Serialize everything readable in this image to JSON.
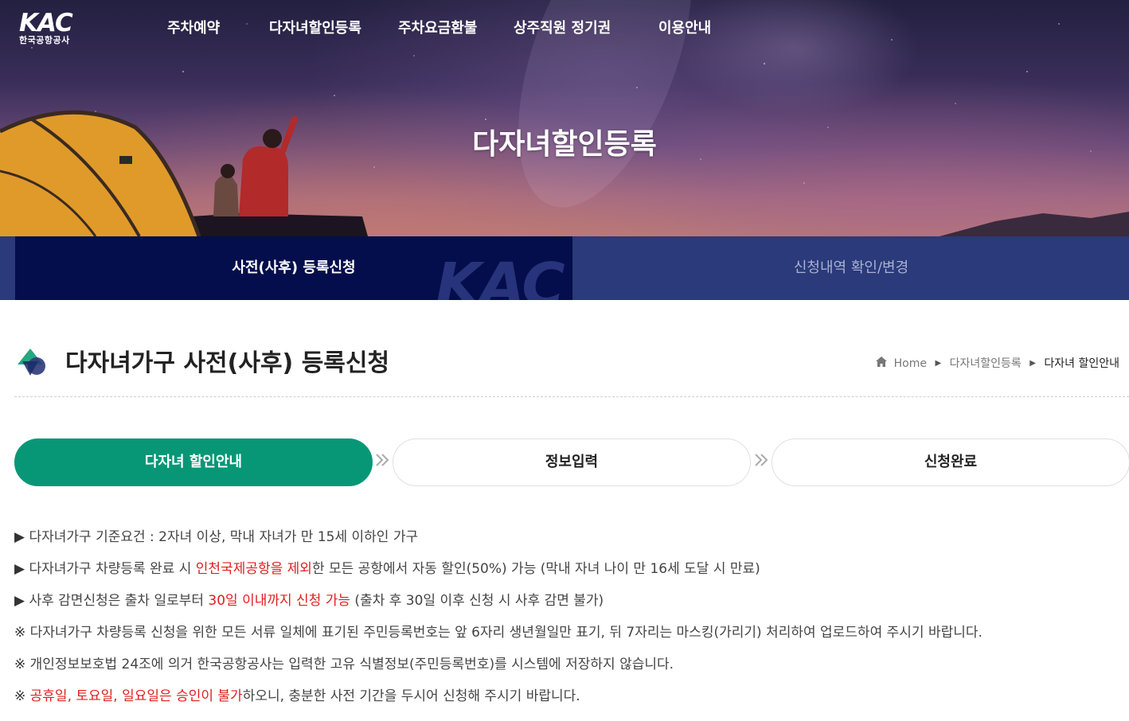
{
  "header": {
    "logo_text": "KAC",
    "logo_subtext": "한국공항공사",
    "nav": [
      "주차예약",
      "다자녀할인등록",
      "주차요금환불",
      "상주직원 정기권",
      "이용안내"
    ],
    "hero_title": "다자녀할인등록"
  },
  "tabs": {
    "active_label": "사전(사후) 등록신청",
    "inactive_label": "신청내역 확인/변경",
    "watermark": "KAC"
  },
  "page": {
    "title": "다자녀가구 사전(사후) 등록신청",
    "breadcrumb": {
      "home": "Home",
      "level1": "다자녀할인등록",
      "current": "다자녀 할인안내"
    }
  },
  "steps": [
    {
      "label": "다자녀 할인안내",
      "active": true
    },
    {
      "label": "정보입력",
      "active": false
    },
    {
      "label": "신청완료",
      "active": false
    }
  ],
  "notices": [
    {
      "bullet": "▶",
      "parts": [
        {
          "text": " 다자녀가구 기준요건 : 2자녀 이상, 막내 자녀가 만 15세 이하인 가구"
        }
      ]
    },
    {
      "bullet": "▶",
      "parts": [
        {
          "text": " 다자녀가구 차량등록 완료 시 "
        },
        {
          "text": "인천국제공항을 제외",
          "red": true
        },
        {
          "text": "한 모든 공항에서 자동 할인(50%) 가능 (막내 자녀 나이 만 16세 도달 시 만료)"
        }
      ]
    },
    {
      "bullet": "▶",
      "parts": [
        {
          "text": " 사후 감면신청은 출차 일로부터 "
        },
        {
          "text": "30일 이내까지 신청 가능",
          "red": true
        },
        {
          "text": " (출차 후 30일 이후 신청 시 사후 감면 불가)"
        }
      ]
    },
    {
      "bullet": "※",
      "parts": [
        {
          "text": " 다자녀가구 차량등록 신청을 위한 모든 서류 일체에 표기된 주민등록번호는 앞 6자리 생년월일만 표기, 뒤 7자리는 마스킹(가리기) 처리하여 업로드하여 주시기 바랍니다."
        }
      ]
    },
    {
      "bullet": "※",
      "parts": [
        {
          "text": " 개인정보보호법 24조에 의거 한국공항공사는 입력한 고유 식별정보(주민등록번호)를 시스템에 저장하지 않습니다."
        }
      ]
    },
    {
      "bullet": "※",
      "parts": [
        {
          "text": " "
        },
        {
          "text": "공휴일, 토요일, 일요일은 승인이 불가",
          "red": true
        },
        {
          "text": "하오니, 충분한 사전 기간을 두시어 신청해 주시기 바랍니다."
        }
      ]
    }
  ],
  "colors": {
    "accent_green": "#079777",
    "tab_active_bg": "#050e4c",
    "tab_inactive_bg": "#2a3a7a",
    "highlight_red": "#e01e1e"
  },
  "icons": [
    "home-icon",
    "breadcrumb-arrow-icon",
    "double-chevron-icon",
    "page-logo-icon"
  ]
}
